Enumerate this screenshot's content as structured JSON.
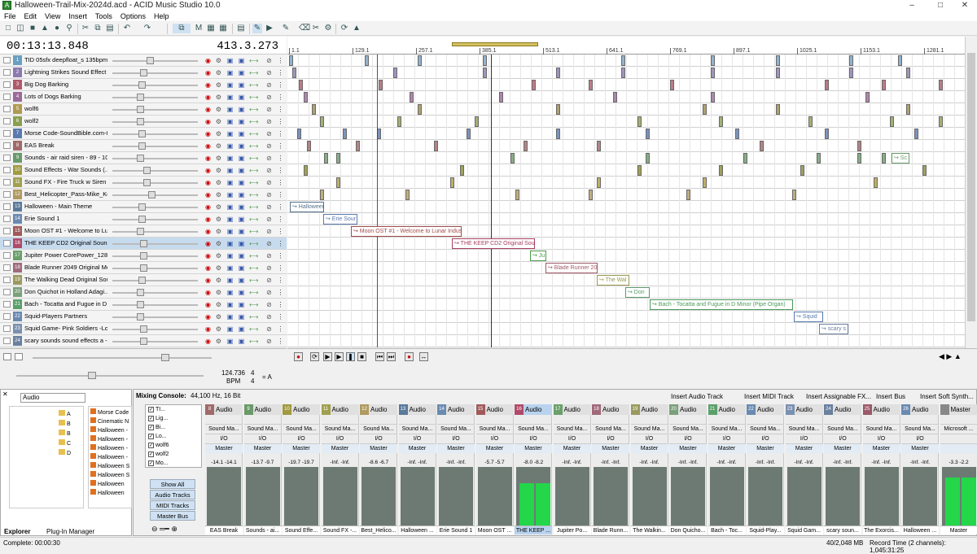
{
  "window": {
    "title": "Halloween-Trail-Mix-2024d.acd - ACID Music Studio 10.0",
    "app_icon": "A"
  },
  "menu": [
    "File",
    "Edit",
    "View",
    "Insert",
    "Tools",
    "Options",
    "Help"
  ],
  "time": {
    "timecode": "00:13:13.848",
    "measure": "413.3.273"
  },
  "ruler_marks": [
    "1.1",
    "129.1",
    "257.1",
    "385.1",
    "513.1",
    "641.1",
    "769.1",
    "897.1",
    "1025.1",
    "1153.1",
    "1281.1"
  ],
  "tracks": [
    {
      "num": "1",
      "name": "TID 05sfx deepfloat_s 135bpm",
      "color": "#6aa0c0"
    },
    {
      "num": "2",
      "name": "Lightning Strikes Sound Effect",
      "color": "#8a7ab0"
    },
    {
      "num": "3",
      "name": "Big Dog Barking",
      "color": "#b05a6a"
    },
    {
      "num": "4",
      "name": "Lots of Dogs Barking",
      "color": "#9a6a9a"
    },
    {
      "num": "5",
      "name": "wolf6",
      "color": "#b09a50"
    },
    {
      "num": "6",
      "name": "wolf2",
      "color": "#8aa050"
    },
    {
      "num": "7",
      "name": "Morse Code-SoundBible.com-8...",
      "color": "#5a7ab0"
    },
    {
      "num": "8",
      "name": "EAS Break",
      "color": "#a06a6a"
    },
    {
      "num": "9",
      "name": "Sounds - air raid siren - 89 - 10...",
      "color": "#6a9a6a"
    },
    {
      "num": "10",
      "name": "Sound Effects - War Sounds (...",
      "color": "#a09a40"
    },
    {
      "num": "11",
      "name": "Sound FX - Fire Truck w Siren ...",
      "color": "#a0a050"
    },
    {
      "num": "12",
      "name": "Best_Helicopter_Pass-Mike_Ko...",
      "color": "#b09a60"
    },
    {
      "num": "13",
      "name": "Halloween - Main Theme",
      "color": "#5a7a9a"
    },
    {
      "num": "14",
      "name": "Erie Sound 1",
      "color": "#6a8ab0"
    },
    {
      "num": "15",
      "name": "Moon OST #1 - Welcome to Lu...",
      "color": "#a05a5a"
    },
    {
      "num": "16",
      "name": "THE KEEP CD2 Original Soundtr...",
      "color": "#b04a6a"
    },
    {
      "num": "17",
      "name": "Jupiter Power CorePower_128",
      "color": "#6aa06a"
    },
    {
      "num": "18",
      "name": "Blade Runner 2049 Original Mo...",
      "color": "#a06a7a"
    },
    {
      "num": "19",
      "name": "The Walking Dead Original Sou...",
      "color": "#9a9a60"
    },
    {
      "num": "20",
      "name": "Don Quichot in Holland   Adagi...",
      "color": "#7aa07a"
    },
    {
      "num": "21",
      "name": "Bach - Tocatta and Fugue in D ...",
      "color": "#5aa06a"
    },
    {
      "num": "22",
      "name": "Squid-Players Partners",
      "color": "#6a8ab0"
    },
    {
      "num": "23",
      "name": "Squid Game- Pink Soldiers -Long",
      "color": "#7a90b0"
    },
    {
      "num": "24",
      "name": "scary sounds sound effects a -...",
      "color": "#6a80a0"
    }
  ],
  "events": [
    {
      "row": 12,
      "label": "↪ Halloween",
      "color": "#55708a"
    },
    {
      "row": 13,
      "label": "↪ Erie Sour",
      "color": "#5a7ab0"
    },
    {
      "row": 14,
      "label": "↪ Moon OST #1 - Welcome to Lunar Indus",
      "color": "#a04a4a"
    },
    {
      "row": 15,
      "label": "↪ THE KEEP CD2 Original Sound",
      "color": "#a84060"
    },
    {
      "row": 16,
      "label": "↪ Ju",
      "color": "#4a9a4a"
    },
    {
      "row": 17,
      "label": "↪ Blade Runner 20",
      "color": "#a05a6a"
    },
    {
      "row": 18,
      "label": "↪ The Wal",
      "color": "#9a9a50"
    },
    {
      "row": 19,
      "label": "↪ Don",
      "color": "#5a9a6a"
    },
    {
      "row": 20,
      "label": "↪ Bach - Tocatta and Fugue in D Minor (Pipe Organ)",
      "color": "#4a9a5a"
    },
    {
      "row": 21,
      "label": "↪ Squid",
      "color": "#5a7ab0"
    },
    {
      "row": 22,
      "label": "↪ scary s",
      "color": "#6a80a0"
    },
    {
      "row": 8,
      "label": "↪ Sc",
      "color": "#6a9a6a"
    }
  ],
  "tempo": {
    "bpm": "124.736",
    "bpm_label": "BPM",
    "sig_top": "4",
    "sig_bottom": "4",
    "key": "= A"
  },
  "explorer": {
    "location": "Audio",
    "folders": [
      "A",
      "B",
      "B",
      "C",
      "D"
    ],
    "files": [
      "Morse Code",
      "Cinematic N",
      "Halloween -",
      "Halloween -",
      "Halloween -",
      "Halloween -",
      "Halloween S",
      "Halloween S",
      "Halloween",
      "Halloween"
    ],
    "tabs": [
      "Explorer",
      "Plug-In Manager"
    ]
  },
  "mixer": {
    "title": "Mixing Console:",
    "format": "44,100 Hz, 16 Bit",
    "toolbar": [
      "Insert Audio Track",
      "Insert MIDI Track",
      "Insert Assignable FX...",
      "Insert Bus",
      "Insert Soft Synth..."
    ],
    "track_checks": [
      "TI...",
      "Lig...",
      "Bi...",
      "Lo...",
      "wolf6",
      "wolf2",
      "Mo..."
    ],
    "view_buttons": [
      "Show All",
      "Audio Tracks",
      "MIDI Tracks",
      "Master Bus"
    ],
    "strips": [
      {
        "num": "8",
        "label": "Audio",
        "device": "Sound Ma...",
        "io": "I/O",
        "out": "Master",
        "l": "-14.1",
        "r": "-14.1",
        "name": "EAS Break",
        "lv": 0,
        "color": "#a06a6a"
      },
      {
        "num": "9",
        "label": "Audio",
        "device": "Sound Ma...",
        "io": "I/O",
        "out": "Master",
        "l": "-13.7",
        "r": "-9.7",
        "name": "Sounds - ai...",
        "lv": 0,
        "color": "#6a9a6a"
      },
      {
        "num": "10",
        "label": "Audio",
        "device": "Sound Ma...",
        "io": "I/O",
        "out": "Master",
        "l": "-19.7",
        "r": "-19.7",
        "name": "Sound Effe...",
        "lv": 0,
        "color": "#a09a40"
      },
      {
        "num": "11",
        "label": "Audio",
        "device": "Sound Ma...",
        "io": "I/O",
        "out": "Master",
        "l": "-Inf.",
        "r": "-Inf.",
        "name": "Sound FX -...",
        "lv": 0,
        "color": "#a0a050"
      },
      {
        "num": "12",
        "label": "Audio",
        "device": "Sound Ma...",
        "io": "I/O",
        "out": "Master",
        "l": "-8.6",
        "r": "-6.7",
        "name": "Best_Helico...",
        "lv": 0,
        "color": "#b09a60"
      },
      {
        "num": "13",
        "label": "Audio",
        "device": "Sound Ma...",
        "io": "I/O",
        "out": "Master",
        "l": "-Inf.",
        "r": "-Inf.",
        "name": "Halloween ...",
        "lv": 0,
        "color": "#5a7a9a"
      },
      {
        "num": "14",
        "label": "Audio",
        "device": "Sound Ma...",
        "io": "I/O",
        "out": "Master",
        "l": "-Inf.",
        "r": "-Inf.",
        "name": "Erie Sound 1",
        "lv": 0,
        "color": "#6a8ab0"
      },
      {
        "num": "15",
        "label": "Audio",
        "device": "Sound Ma...",
        "io": "I/O",
        "out": "Master",
        "l": "-5.7",
        "r": "-5.7",
        "name": "Moon OST ...",
        "lv": 0,
        "color": "#a05a5a"
      },
      {
        "num": "16",
        "label": "Audio",
        "device": "Sound Ma...",
        "io": "I/O",
        "out": "Master",
        "l": "-8.0",
        "r": "-8.2",
        "name": "THE KEEP ...",
        "lv": 0.72,
        "color": "#b04a6a",
        "sel": true
      },
      {
        "num": "17",
        "label": "Audio",
        "device": "Sound Ma...",
        "io": "I/O",
        "out": "Master",
        "l": "-Inf.",
        "r": "-Inf.",
        "name": "Jupiter Po...",
        "lv": 0,
        "color": "#6aa06a"
      },
      {
        "num": "18",
        "label": "Audio",
        "device": "Sound Ma...",
        "io": "I/O",
        "out": "Master",
        "l": "-Inf.",
        "r": "-Inf.",
        "name": "Blade Runn...",
        "lv": 0,
        "color": "#a06a7a"
      },
      {
        "num": "19",
        "label": "Audio",
        "device": "Sound Ma...",
        "io": "I/O",
        "out": "Master",
        "l": "-Inf.",
        "r": "-Inf.",
        "name": "The Walkin...",
        "lv": 0,
        "color": "#9a9a60"
      },
      {
        "num": "20",
        "label": "Audio",
        "device": "Sound Ma...",
        "io": "I/O",
        "out": "Master",
        "l": "-Inf.",
        "r": "-Inf.",
        "name": "Don Quicho...",
        "lv": 0,
        "color": "#7aa07a"
      },
      {
        "num": "21",
        "label": "Audio",
        "device": "Sound Ma...",
        "io": "I/O",
        "out": "Master",
        "l": "-Inf.",
        "r": "-Inf.",
        "name": "Bach - Toc...",
        "lv": 0,
        "color": "#5aa06a"
      },
      {
        "num": "22",
        "label": "Audio",
        "device": "Sound Ma...",
        "io": "I/O",
        "out": "Master",
        "l": "-Inf.",
        "r": "-Inf.",
        "name": "Squid-Play...",
        "lv": 0,
        "color": "#6a8ab0"
      },
      {
        "num": "23",
        "label": "Audio",
        "device": "Sound Ma...",
        "io": "I/O",
        "out": "Master",
        "l": "-Inf.",
        "r": "-Inf.",
        "name": "Squid Gam...",
        "lv": 0,
        "color": "#7a90b0"
      },
      {
        "num": "24",
        "label": "Audio",
        "device": "Sound Ma...",
        "io": "I/O",
        "out": "Master",
        "l": "-Inf.",
        "r": "-Inf.",
        "name": "scary soun...",
        "lv": 0,
        "color": "#6a80a0"
      },
      {
        "num": "25",
        "label": "Audio",
        "device": "Sound Ma...",
        "io": "I/O",
        "out": "Master",
        "l": "-Inf.",
        "r": "-Inf.",
        "name": "The Exorcis...",
        "lv": 0,
        "color": "#9a5a6a"
      },
      {
        "num": "26",
        "label": "Audio",
        "device": "Sound Ma...",
        "io": "I/O",
        "out": "Master",
        "l": "-Inf.",
        "r": "-Inf.",
        "name": "Halloween ...",
        "lv": 0,
        "color": "#6a8ab0"
      },
      {
        "num": "",
        "label": "Master",
        "device": "Microsoft ...",
        "io": "",
        "out": "",
        "l": "-3.3",
        "r": "-2.2",
        "name": "Master",
        "lv": 0.82,
        "color": "#888888"
      }
    ]
  },
  "status": {
    "left": "Complete: 00:00:30",
    "mem": "40/2,048 MB",
    "record": "Record Time (2 channels): 1,045:31:25"
  }
}
